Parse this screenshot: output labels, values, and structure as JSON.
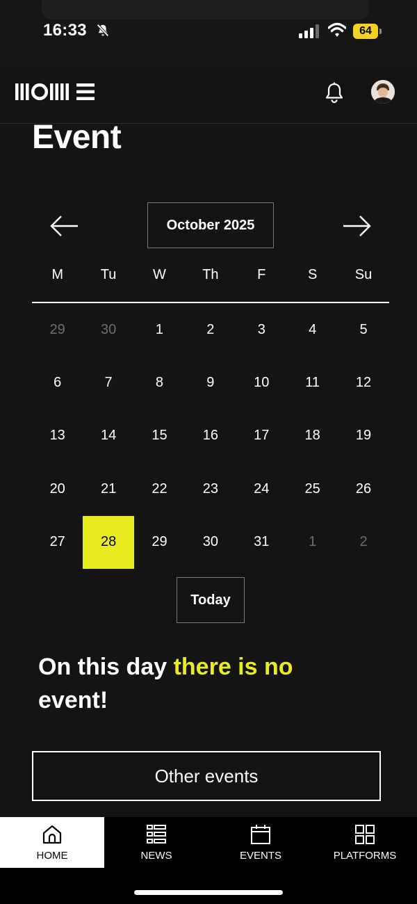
{
  "status_bar": {
    "time": "16:33",
    "battery": "64"
  },
  "header": {
    "logo_text": "MOME"
  },
  "page": {
    "title": "Event"
  },
  "calendar": {
    "month_label": "October 2025",
    "weekdays": [
      "M",
      "Tu",
      "W",
      "Th",
      "F",
      "S",
      "Su"
    ],
    "weeks": [
      [
        "29",
        "30",
        "1",
        "2",
        "3",
        "4",
        "5"
      ],
      [
        "6",
        "7",
        "8",
        "9",
        "10",
        "11",
        "12"
      ],
      [
        "13",
        "14",
        "15",
        "16",
        "17",
        "18",
        "19"
      ],
      [
        "20",
        "21",
        "22",
        "23",
        "24",
        "25",
        "26"
      ],
      [
        "27",
        "28",
        "29",
        "30",
        "31",
        "1",
        "2"
      ]
    ],
    "selected_day": "28",
    "today_label": "Today"
  },
  "message": {
    "part1": "On this day ",
    "highlight": "there is no",
    "part2": "event!"
  },
  "other_events_label": "Other events",
  "bottom_nav": {
    "home": "HOME",
    "news": "NEWS",
    "events": "EVENTS",
    "platforms": "PLATFORMS"
  },
  "colors": {
    "background": "#141414",
    "accent": "#e9ec1f",
    "battery": "#f3d125"
  }
}
